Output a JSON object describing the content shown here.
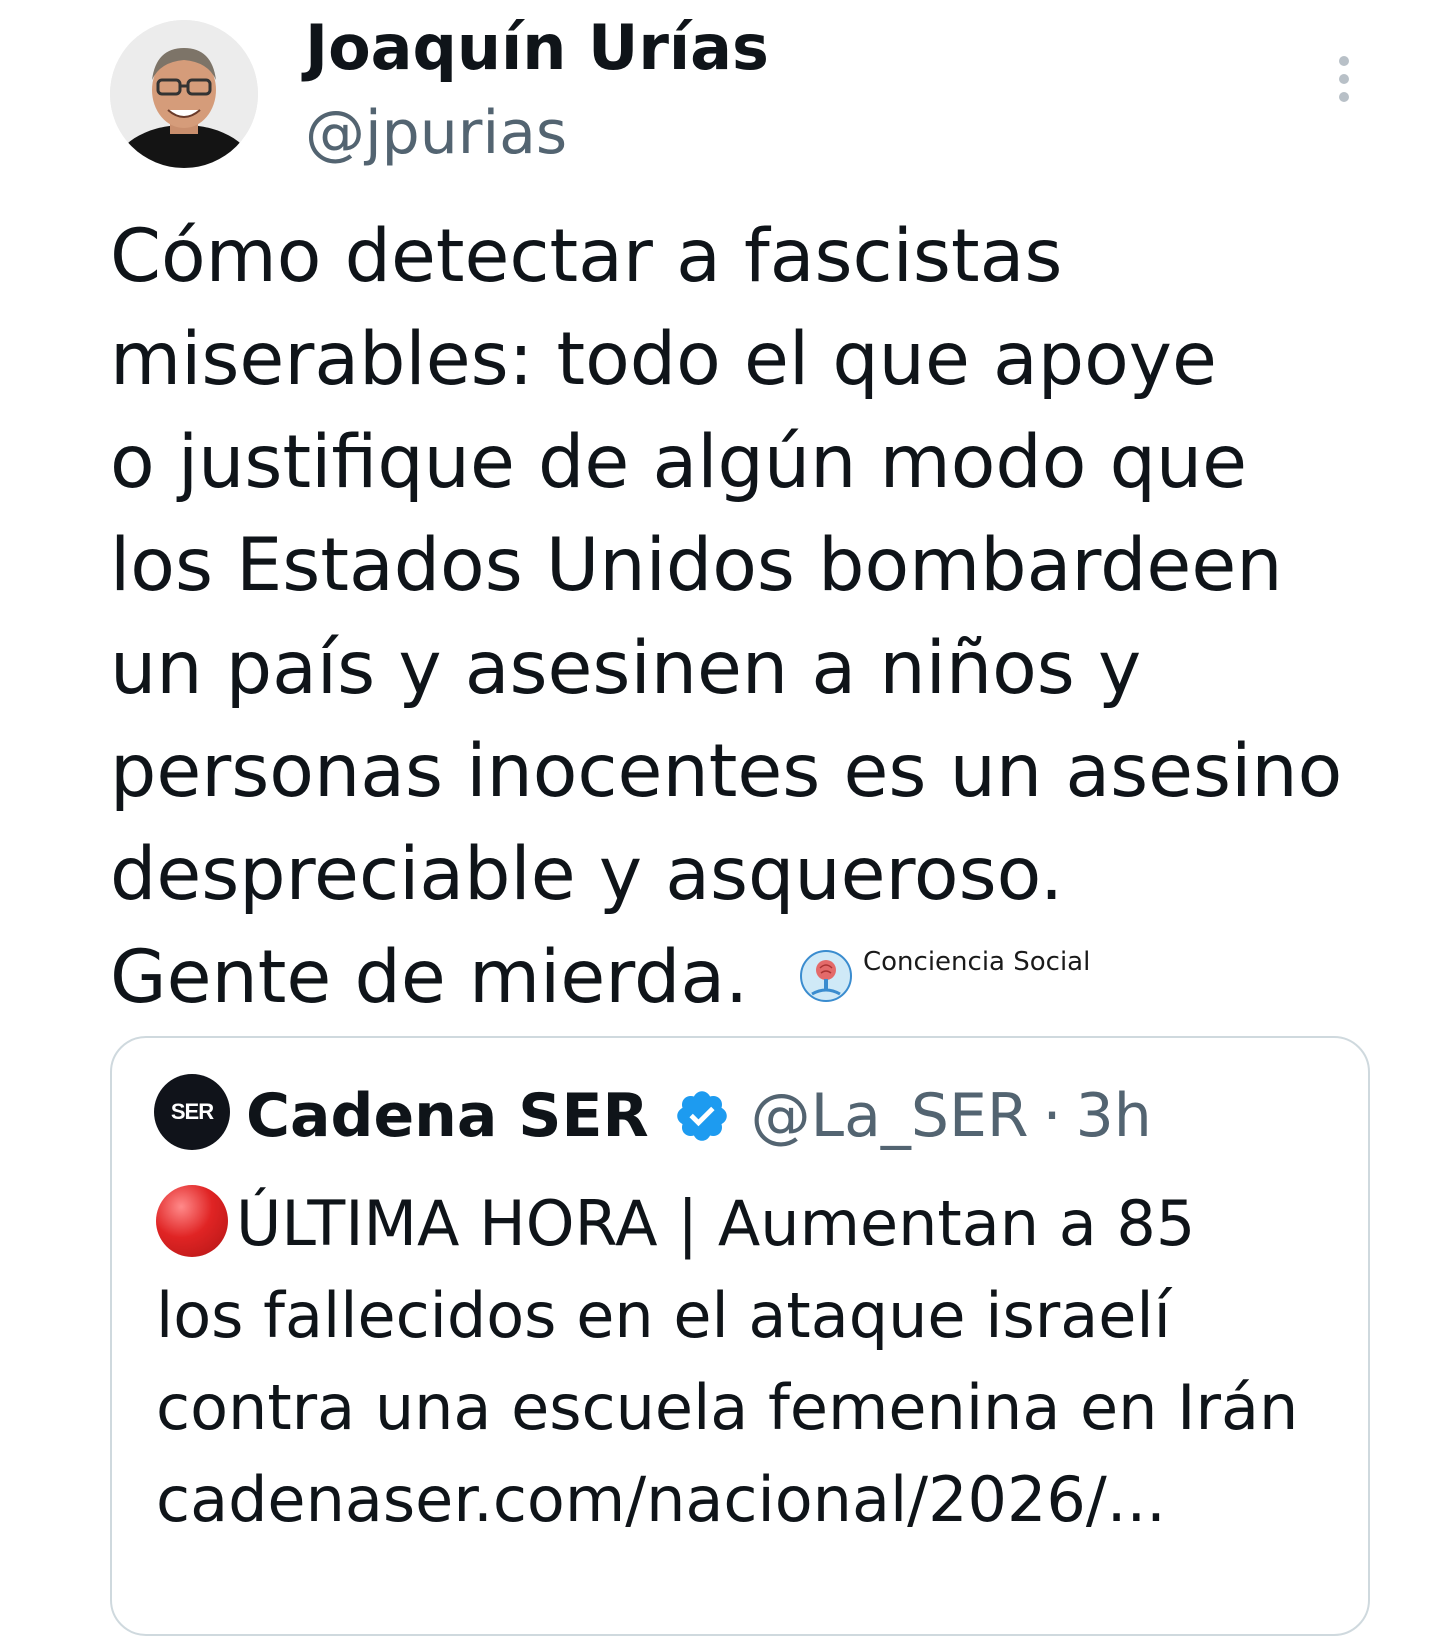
{
  "tweet": {
    "author": {
      "display_name": "Joaquín Urías",
      "handle": "@jpurias"
    },
    "text": "Cómo detectar a fascistas\nmiserables: todo el que apoye\no justifique de algún modo  que\nlos Estados Unidos bombardeen\nun país y asesinen a niños y\npersonas inocentes es un asesino\ndespreciable y asqueroso.\nGente de mierda.",
    "more_icon": "more-vertical-icon"
  },
  "watermark": {
    "text": "Conciencia Social",
    "icon": "brain-tree-logo"
  },
  "quoted_tweet": {
    "author": {
      "display_name": "Cadena SER",
      "handle": "@La_SER",
      "avatar_text": "SER",
      "verified": true
    },
    "separator": "·",
    "timestamp": "3h",
    "lines": [
      "ÚLTIMA HORA | Aumentan a 85",
      "los fallecidos en el ataque israelí",
      "contra una escuela femenina en Irán",
      "cadenaser.com/nacional/2026/..."
    ],
    "leading_emoji": "red-circle-icon"
  },
  "colors": {
    "text_primary": "#0f1419",
    "text_secondary": "#536471",
    "verified_blue": "#1d9bf0",
    "card_border": "#cfd9de",
    "red_circle": "#e02424"
  }
}
